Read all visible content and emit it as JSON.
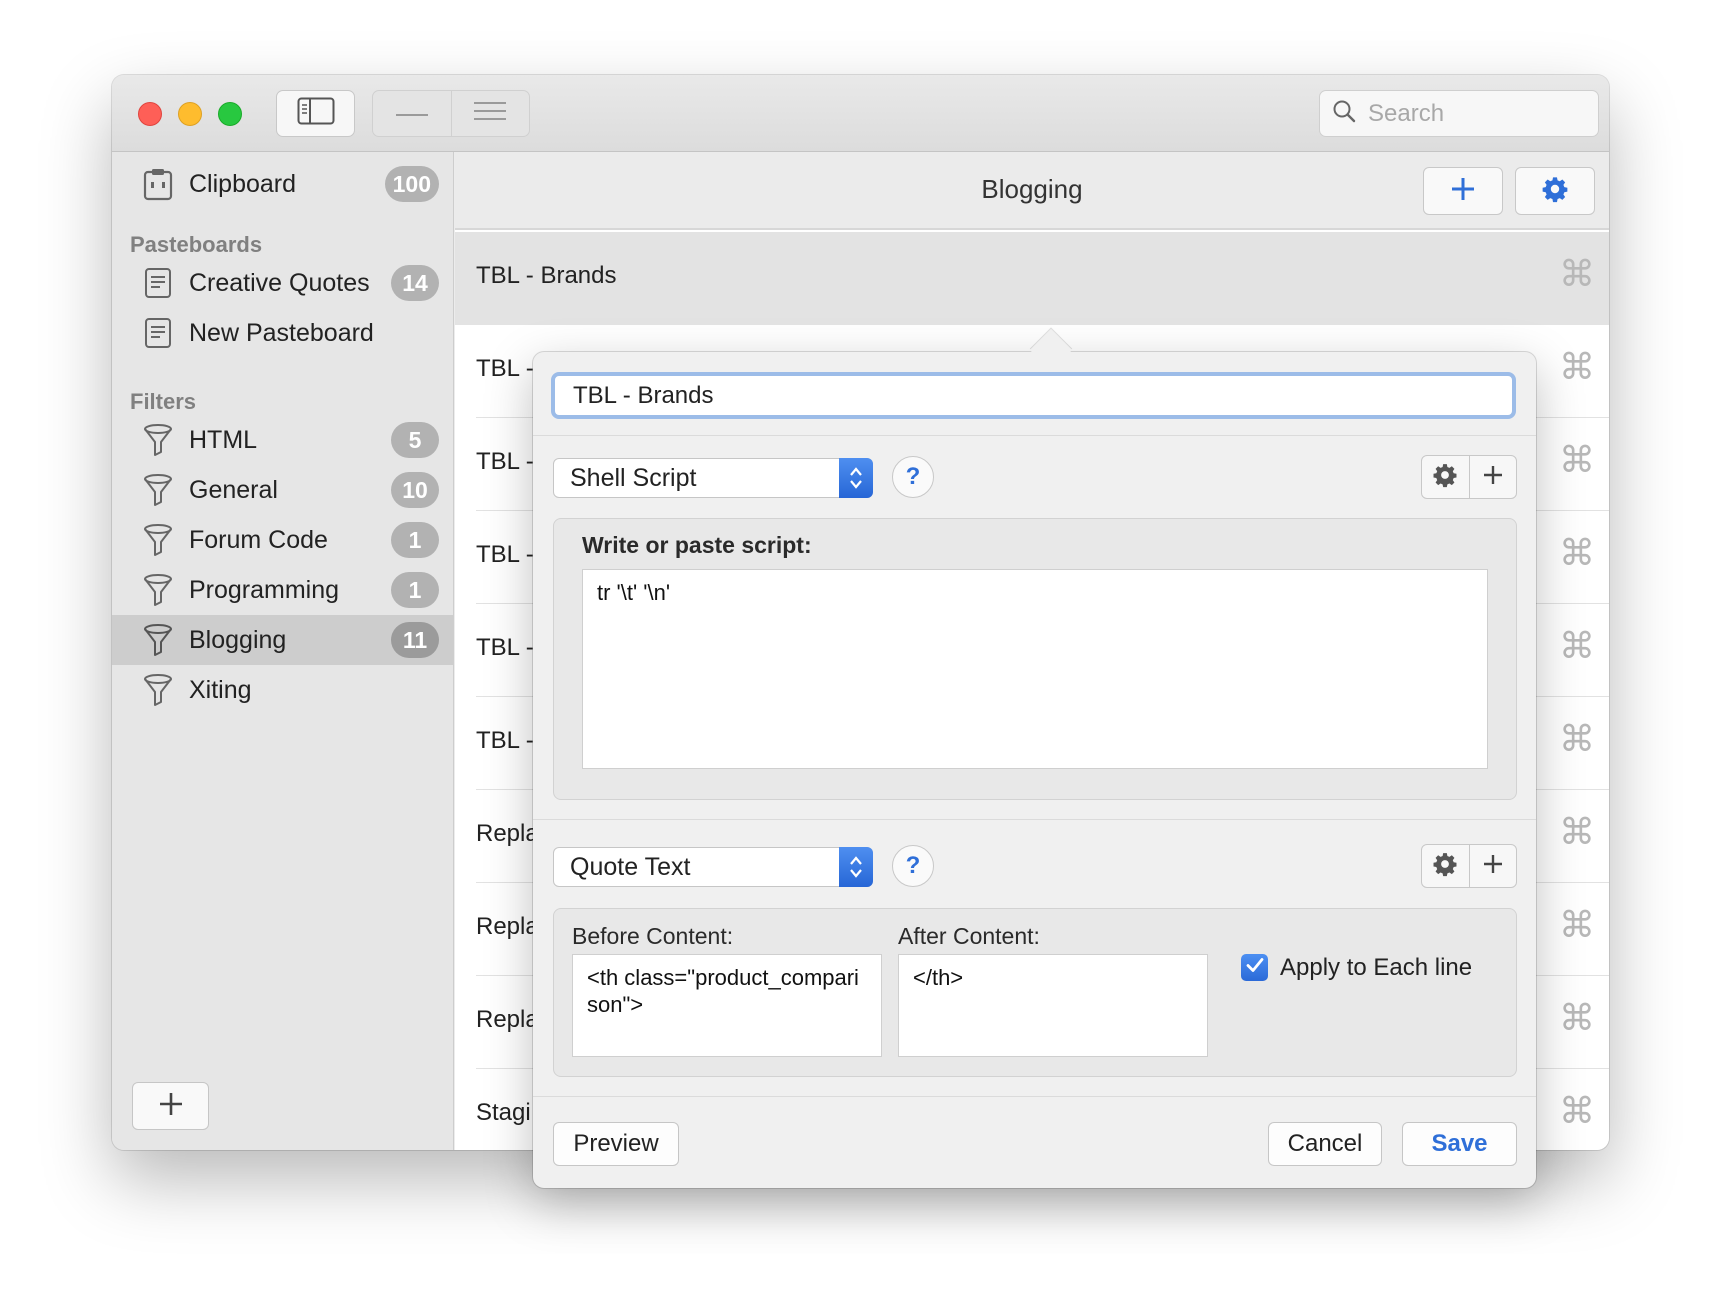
{
  "window": {
    "search_placeholder": "Search"
  },
  "sidebar": {
    "clipboard": {
      "label": "Clipboard",
      "count": "100"
    },
    "pasteboards_heading": "Pasteboards",
    "pasteboards": [
      {
        "label": "Creative Quotes",
        "count": "14"
      },
      {
        "label": "New Pasteboard",
        "count": ""
      }
    ],
    "filters_heading": "Filters",
    "filters": [
      {
        "label": "HTML",
        "count": "5"
      },
      {
        "label": "General",
        "count": "10"
      },
      {
        "label": "Forum Code",
        "count": "1"
      },
      {
        "label": "Programming",
        "count": "1"
      },
      {
        "label": "Blogging",
        "count": "11"
      },
      {
        "label": "Xiting",
        "count": ""
      }
    ]
  },
  "content": {
    "title": "Blogging",
    "rows": [
      {
        "label": "TBL - Brands",
        "shortcut": "⌘"
      },
      {
        "label": "TBL -",
        "shortcut": "⌘"
      },
      {
        "label": "TBL -",
        "shortcut": "⌘"
      },
      {
        "label": "TBL -",
        "shortcut": "⌘"
      },
      {
        "label": "TBL -",
        "shortcut": "⌘"
      },
      {
        "label": "TBL -",
        "shortcut": "⌘"
      },
      {
        "label": "Repla",
        "shortcut": "⌘"
      },
      {
        "label": "Repla",
        "shortcut": "⌘"
      },
      {
        "label": "Repla",
        "shortcut": "⌘"
      },
      {
        "label": "Stagi",
        "shortcut": "⌘"
      }
    ]
  },
  "editor": {
    "name_value": "TBL - Brands",
    "action1": {
      "type": "Shell Script",
      "help": "?",
      "script_label": "Write or paste script:",
      "script_value": "tr '\\t' '\\n'"
    },
    "action2": {
      "type": "Quote Text",
      "help": "?",
      "before_label": "Before Content:",
      "before_value": "<th class=\"product_comparison\">",
      "after_label": "After Content:",
      "after_value": "</th>",
      "apply_label": "Apply to Each line",
      "apply_checked": true
    },
    "preview_label": "Preview",
    "cancel_label": "Cancel",
    "save_label": "Save"
  },
  "colors": {
    "accent": "#2f6fd8",
    "close": "#fe5f57",
    "minimize": "#febc2e",
    "maximize": "#28c840"
  }
}
